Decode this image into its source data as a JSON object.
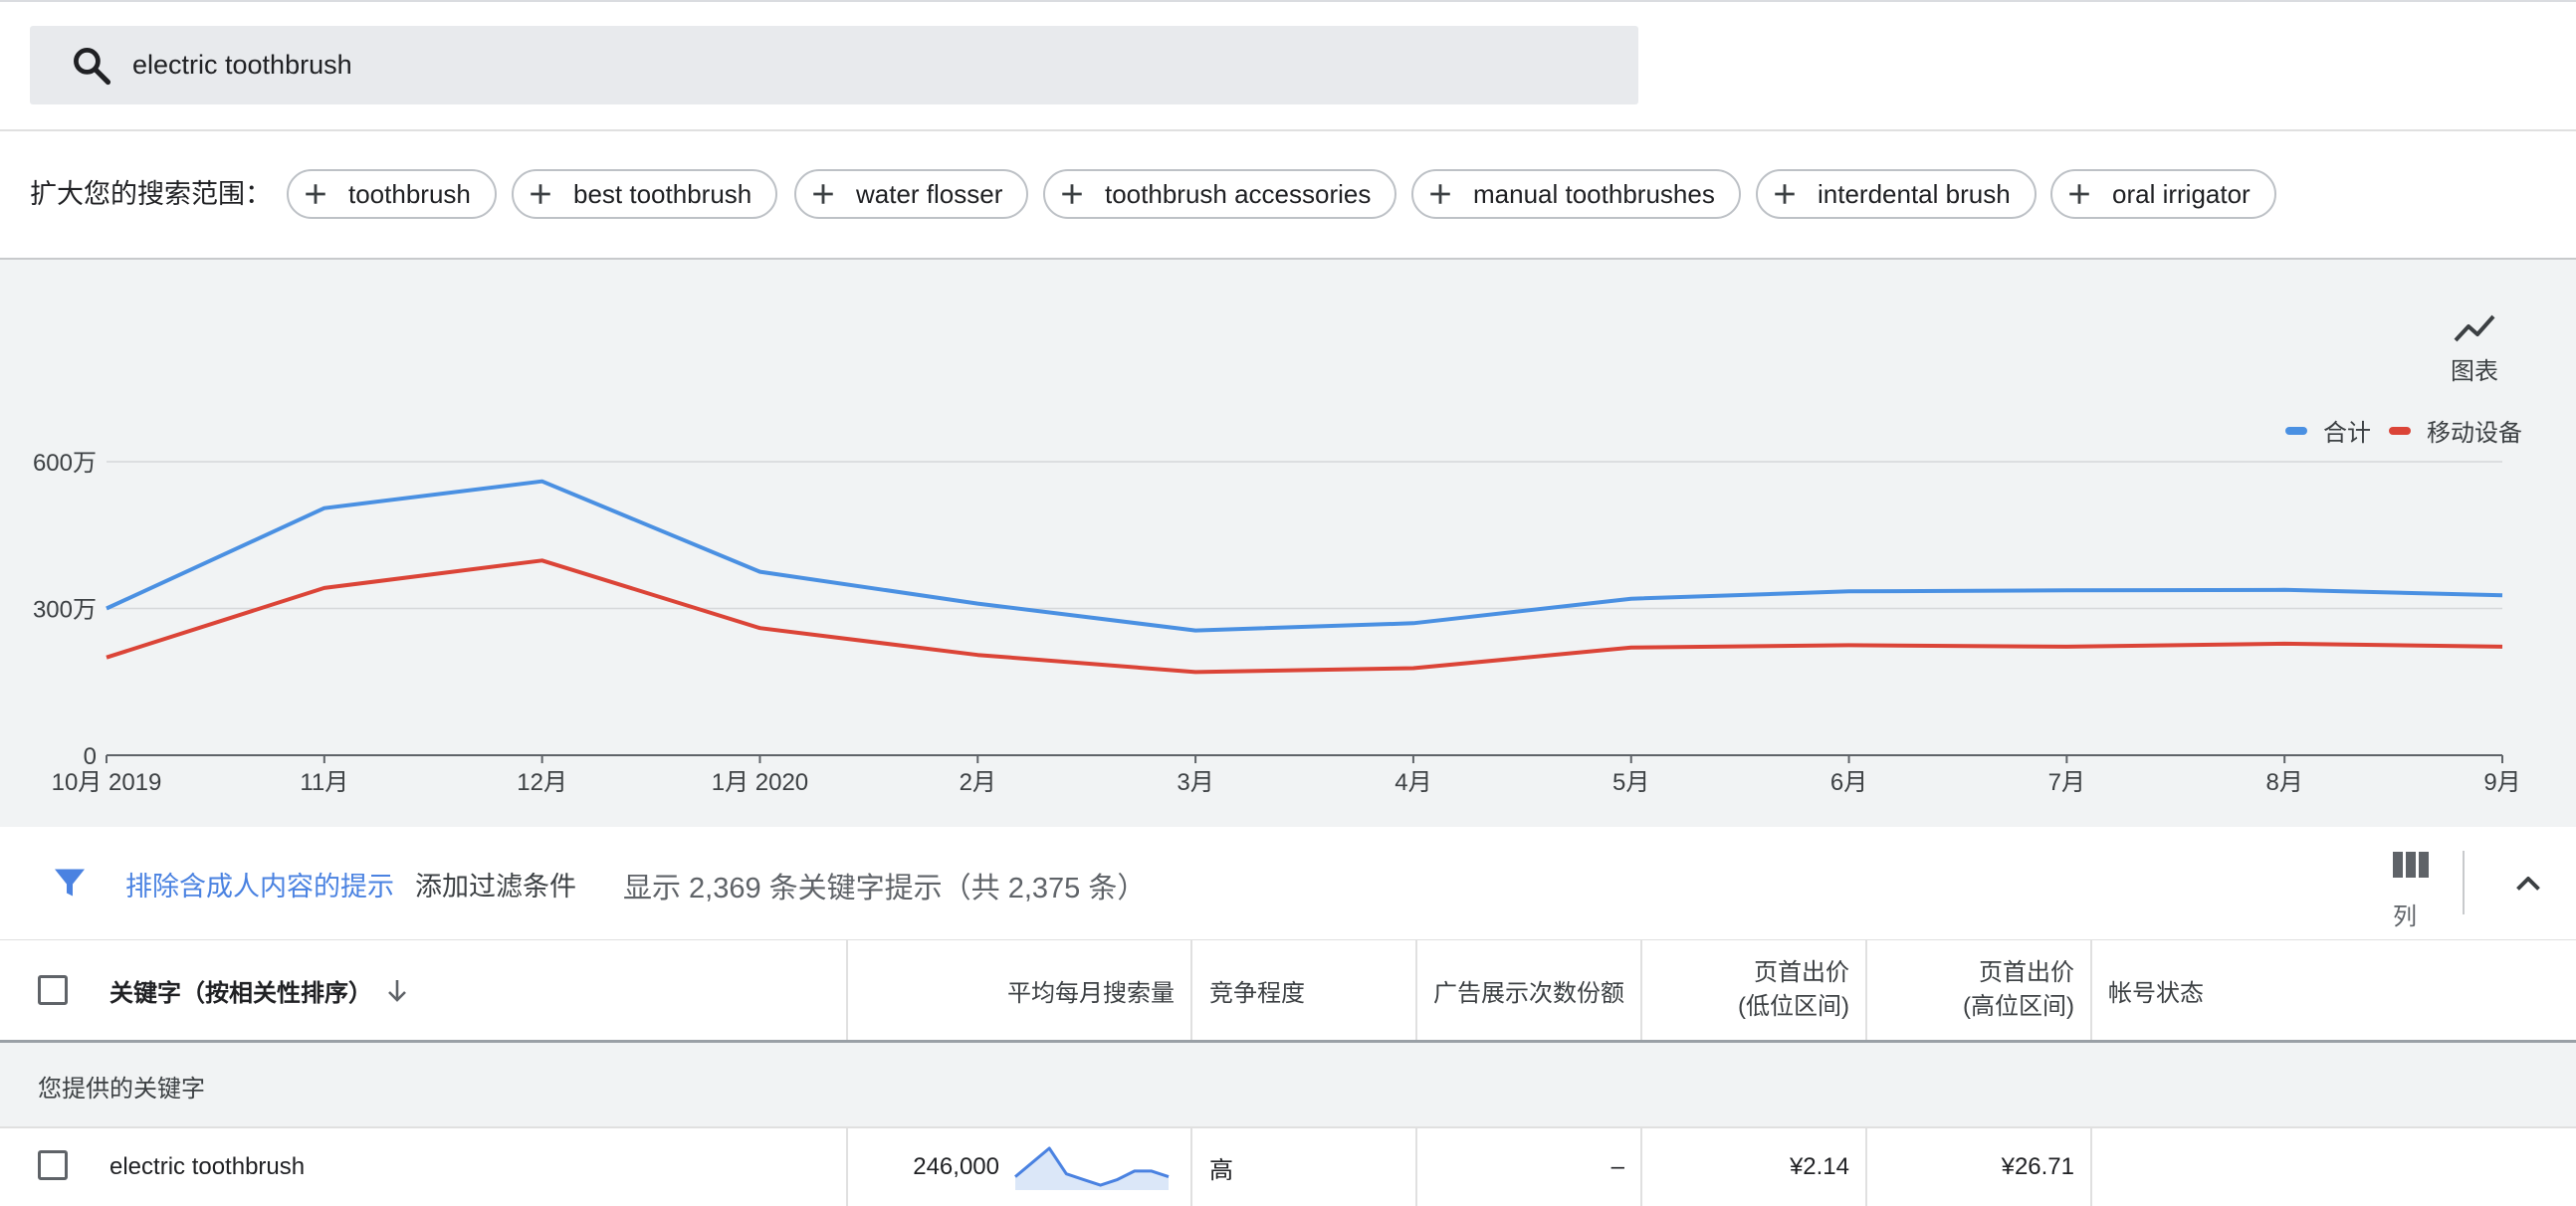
{
  "search": {
    "query": "electric toothbrush",
    "icon": "search-icon"
  },
  "broaden": {
    "label": "扩大您的搜索范围：",
    "chips": [
      "toothbrush",
      "best toothbrush",
      "water flosser",
      "toothbrush accessories",
      "manual toothbrushes",
      "interdental brush",
      "oral irrigator"
    ]
  },
  "chart_toggle": {
    "label": "图表",
    "icon": "line-chart-icon"
  },
  "chart_data": {
    "type": "line",
    "x": [
      "10月 2019",
      "11月",
      "12月",
      "1月 2020",
      "2月",
      "3月",
      "4月",
      "5月",
      "6月",
      "7月",
      "8月",
      "9月"
    ],
    "series": [
      {
        "name": "合计",
        "color": "#4a90e2",
        "values": [
          3000000,
          5050000,
          5600000,
          3750000,
          3100000,
          2550000,
          2700000,
          3200000,
          3350000,
          3370000,
          3380000,
          3270000
        ]
      },
      {
        "name": "移动设备",
        "color": "#db4437",
        "values": [
          2000000,
          3420000,
          3980000,
          2600000,
          2050000,
          1700000,
          1780000,
          2200000,
          2250000,
          2220000,
          2280000,
          2220000
        ]
      }
    ],
    "y_ticks": [
      "0",
      "300万",
      "600万"
    ],
    "ylim": [
      0,
      6000000
    ],
    "grid": true,
    "legend": "top-right"
  },
  "filter": {
    "adult_filter": "排除含成人内容的提示",
    "add_filter": "添加过滤条件",
    "count_text": "显示 2,369 条关键字提示（共 2,375 条）",
    "columns_label": "列"
  },
  "table": {
    "headers": {
      "keyword": "关键字（按相关性排序）",
      "avg_searches": "平均每月搜索量",
      "competition": "竞争程度",
      "impression_share": "广告展示次数份额",
      "bid_low_1": "页首出价",
      "bid_low_2": "(低位区间)",
      "bid_high_1": "页首出价",
      "bid_high_2": "(高位区间)",
      "account_status": "帐号状态"
    },
    "group_label": "您提供的关键字",
    "rows": [
      {
        "keyword": "electric toothbrush",
        "avg_searches": "246,000",
        "competition": "高",
        "impression_share": "–",
        "bid_low": "¥2.14",
        "bid_high": "¥26.71",
        "account_status": "",
        "trend": [
          4,
          9,
          14,
          5,
          3,
          1,
          3,
          6,
          6,
          4
        ]
      }
    ]
  }
}
